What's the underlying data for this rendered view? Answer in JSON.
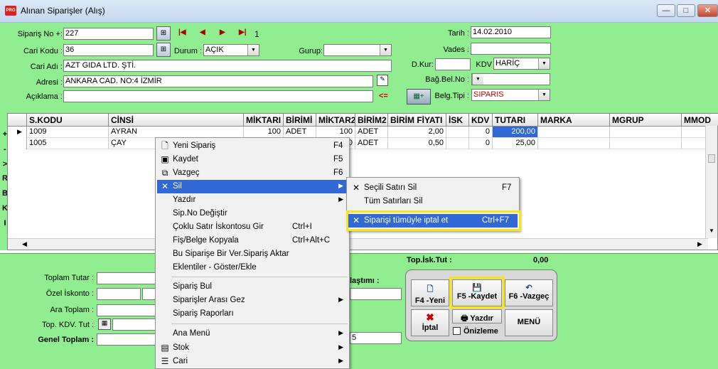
{
  "window": {
    "title": "Alınan Siparişler (Alış)",
    "app_icon": "app-logo-icon",
    "min": "—",
    "max": "□",
    "close": "✕"
  },
  "form": {
    "sipno_label": "Sipariş No +:",
    "sipno": "227",
    "record_no": "1",
    "cari_kodu_label": "Cari Kodu :",
    "cari_kodu": "36",
    "durum_label": "Durum :",
    "durum": "AÇIK",
    "gurup_label": "Gurup:",
    "gurup": "",
    "cari_adi_label": "Cari Adı :",
    "cari_adi": "AZT GIDA LTD. ŞTİ.",
    "adresi_label": "Adresi :",
    "adresi": "ANKARA CAD. NO:4 İZMİR",
    "aciklama_label": "Açıklama :",
    "aciklama": "",
    "arrow_text": "<=",
    "tarih_label": "Tarih :",
    "tarih": "14.02.2010",
    "vades_label": "Vades :",
    "vades": "",
    "dkur_label": "D.Kur:",
    "dkur": "",
    "kdv_label": "KDV",
    "kdv": "HARİÇ",
    "bagbel_label": "Bağ.Bel.No :",
    "bagbel": "",
    "belgtipi_label": "Belg.Tipi :",
    "belgtipi": "SIPARIS"
  },
  "grid": {
    "columns": [
      "S.KODU",
      "CİNSİ",
      "MİKTARI",
      "BİRİMİ",
      "MİKTAR2",
      "BİRİM2",
      "BİRİM FİYATI",
      "İSK",
      "KDV",
      "TUTARI",
      "MARKA",
      "MGRUP",
      "MMOD"
    ],
    "rows": [
      [
        "1009",
        "AYRAN",
        "100",
        "ADET",
        "100",
        "ADET",
        "2,00",
        "",
        "0",
        "200,00",
        "",
        "",
        ""
      ],
      [
        "1005",
        "ÇAY",
        "",
        "",
        "0",
        "ADET",
        "0,50",
        "",
        "0",
        "25,00",
        "",
        "",
        ""
      ]
    ],
    "side_letters": [
      "+",
      "-",
      ">",
      "R",
      "B",
      "K",
      "I"
    ],
    "current_row_marker": "▶"
  },
  "context_menu": {
    "items": [
      {
        "label": "Yeni Sipariş",
        "shortcut": "F4",
        "icon": "new-document-icon"
      },
      {
        "label": "Kaydet",
        "shortcut": "F5",
        "icon": "save-icon"
      },
      {
        "label": "Vazgeç",
        "shortcut": "F6",
        "icon": "undo-icon"
      },
      {
        "label": "Sil",
        "shortcut": "",
        "icon": "delete-icon",
        "submenu": true
      },
      {
        "label": "Yazdır",
        "shortcut": "",
        "submenu": true
      },
      {
        "label": "Sip.No Değiştir",
        "shortcut": ""
      },
      {
        "label": "Çoklu Satır İskontosu Gir",
        "shortcut": "Ctrl+I"
      },
      {
        "label": "Fiş/Belge Kopyala",
        "shortcut": "Ctrl+Alt+C"
      },
      {
        "label": "Bu Siparişe Bir Ver.Sipariş Aktar",
        "shortcut": ""
      },
      {
        "label": "Eklentiler - Göster/Ekle",
        "shortcut": ""
      },
      {
        "label": "Sipariş Bul",
        "shortcut": ""
      },
      {
        "label": "Siparişler Arası Gez",
        "shortcut": "",
        "submenu": true
      },
      {
        "label": "Sipariş Raporları",
        "shortcut": ""
      },
      {
        "label": "Ana Menü",
        "shortcut": "",
        "submenu": true
      },
      {
        "label": "Stok",
        "shortcut": "",
        "icon": "stock-icon",
        "submenu": true
      },
      {
        "label": "Cari",
        "shortcut": "",
        "icon": "list-icon",
        "submenu": true
      }
    ]
  },
  "submenu": {
    "items": [
      {
        "label": "Seçili Satırı Sil",
        "shortcut": "F7"
      },
      {
        "label": "Tüm Satırları Sil",
        "shortcut": ""
      },
      {
        "label": "Siparişi tümüyle iptal et",
        "shortcut": "Ctrl+F7"
      }
    ]
  },
  "totals": {
    "top_isk_tut_label": "Top.İsk.Tut :",
    "top_isk_tut": "0,00",
    "toplam_tutar_label": "Toplam Tutar :",
    "ozel_iskonto_label": "Özel İskonto :",
    "ara_toplam_label": "Ara Toplam :",
    "top_kdv_tut_label": "Top. KDV. Tut :",
    "genel_toplam_label": "Genel Toplam :",
    "odeme_label": "laştımı :",
    "partial_value": "5"
  },
  "buttons": {
    "yeni": "F4 -Yeni",
    "kaydet": "F5 -Kaydet",
    "vazgec": "F6 -Vazgeç",
    "iptal": "İptal",
    "yazdir": "Yazdır",
    "onizleme": "Önizleme",
    "menu": "MENÜ"
  },
  "colors": {
    "panel_green": "#90ee90",
    "highlight_blue": "#3168d5",
    "annotation_yellow": "#f5e61a"
  }
}
